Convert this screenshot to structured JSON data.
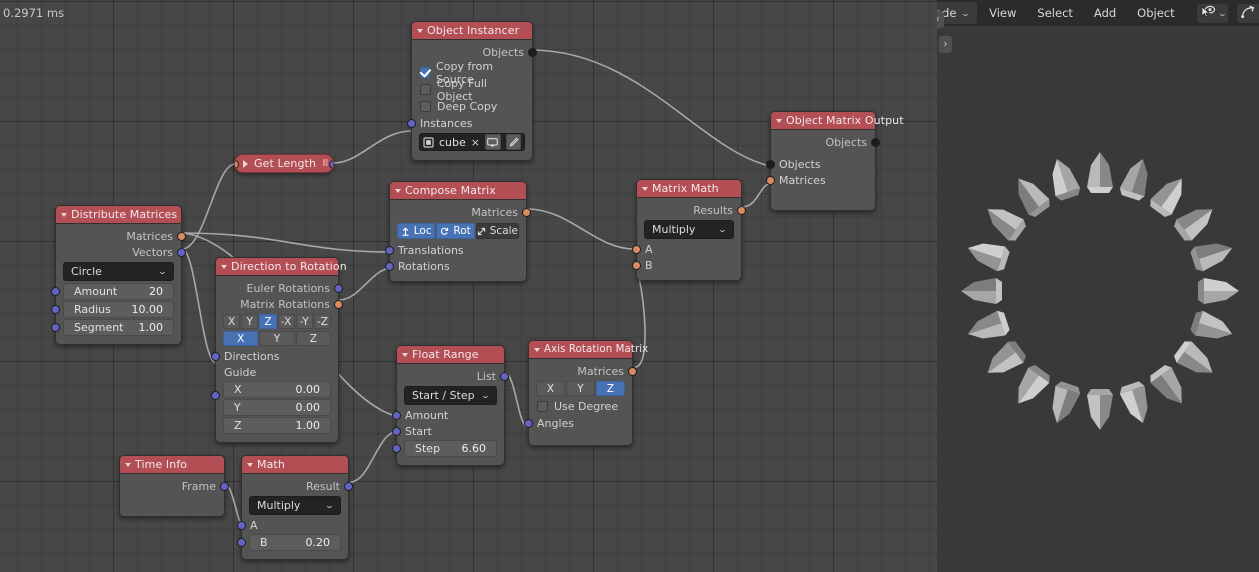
{
  "editor": {
    "timer": "0.2971 ms",
    "nodes": [
      {
        "id": "object_instancer",
        "title": "Object Instancer",
        "outputs": [
          "Objects"
        ],
        "checkboxes": [
          {
            "label": "Copy from Source",
            "checked": true
          },
          {
            "label": "Copy Full Object",
            "checked": false
          },
          {
            "label": "Deep Copy",
            "checked": false
          }
        ],
        "inputs": [
          "Instances"
        ],
        "object_field": {
          "value": "cube",
          "clear_label": "×"
        }
      },
      {
        "id": "get_length",
        "title": "Get Length",
        "collapsed": true,
        "badge": "II"
      },
      {
        "id": "distribute_matrices",
        "title": "Distribute Matrices",
        "outputs": [
          "Matrices",
          "Vectors"
        ],
        "dropdown": "Circle",
        "fields": [
          {
            "label": "Amount",
            "value": "20"
          },
          {
            "label": "Radius",
            "value": "10.00"
          },
          {
            "label": "Segment",
            "value": "1.00"
          }
        ]
      },
      {
        "id": "direction_to_rotation",
        "title": "Direction to Rotation",
        "outputs": [
          "Euler Rotations",
          "Matrix Rotations"
        ],
        "axis_row_1": {
          "options": [
            "X",
            "Y",
            "Z",
            "-X",
            "-Y",
            "-Z"
          ],
          "selected": "Z"
        },
        "axis_row_2": {
          "options": [
            "X",
            "Y",
            "Z"
          ],
          "selected": "X"
        },
        "inputs": [
          "Directions",
          "Guide"
        ],
        "fields": [
          {
            "label": "X",
            "value": "0.00"
          },
          {
            "label": "Y",
            "value": "0.00"
          },
          {
            "label": "Z",
            "value": "1.00"
          }
        ]
      },
      {
        "id": "compose_matrix",
        "title": "Compose Matrix",
        "outputs": [
          "Matrices"
        ],
        "toggles": [
          {
            "label": "Loc",
            "icon": "up-arrow-icon",
            "on": true
          },
          {
            "label": "Rot",
            "icon": "rotate-icon",
            "on": true
          },
          {
            "label": "Scale",
            "icon": "scale-icon",
            "on": false
          }
        ],
        "inputs": [
          "Translations",
          "Rotations"
        ]
      },
      {
        "id": "matrix_math",
        "title": "Matrix Math",
        "outputs": [
          "Results"
        ],
        "dropdown": "Multiply",
        "inputs": [
          "A",
          "B"
        ]
      },
      {
        "id": "object_matrix_output",
        "title": "Object Matrix Output",
        "outputs": [
          "Objects"
        ],
        "inputs": [
          "Objects",
          "Matrices"
        ]
      },
      {
        "id": "float_range",
        "title": "Float Range",
        "outputs": [
          "List"
        ],
        "dropdown": "Start / Step",
        "inputs": [
          "Amount",
          "Start"
        ],
        "fields": [
          {
            "label": "Step",
            "value": "6.60"
          }
        ]
      },
      {
        "id": "axis_rotation_matrix",
        "title": "Axis Rotation Matrix",
        "outputs": [
          "Matrices"
        ],
        "axis_row": {
          "options": [
            "X",
            "Y",
            "Z"
          ],
          "selected": "Z"
        },
        "checkboxes": [
          {
            "label": "Use Degree",
            "checked": false
          }
        ],
        "inputs": [
          "Angles"
        ]
      },
      {
        "id": "time_info",
        "title": "Time Info",
        "outputs": [
          "Frame"
        ]
      },
      {
        "id": "math",
        "title": "Math",
        "outputs": [
          "Result"
        ],
        "dropdown": "Multiply",
        "inputs": [
          "A"
        ],
        "fields": [
          {
            "label": "B",
            "value": "0.20"
          }
        ]
      }
    ]
  },
  "viewport": {
    "mode_label": "ode",
    "menus": [
      "View",
      "Select",
      "Add",
      "Object"
    ],
    "icons": {
      "select_mode": "cursor-select-icon",
      "select_chevron": "chevron-down-icon",
      "snap": "snap-magnet-icon",
      "snap_chevron": "chevron-down-icon",
      "shading": "shading-sphere-icon"
    },
    "panel_toggle_left": "‹",
    "panel_toggle_right": "›"
  },
  "colors": {
    "header_red": "#b34e55",
    "node_body": "#545454",
    "accent_blue": "#4772b3",
    "socket_vector": "#6363c7",
    "socket_matrix": "#d98c5f",
    "socket_object": "#1d1d1d",
    "editor_bg": "#474747",
    "viewport_bg": "#393939"
  }
}
